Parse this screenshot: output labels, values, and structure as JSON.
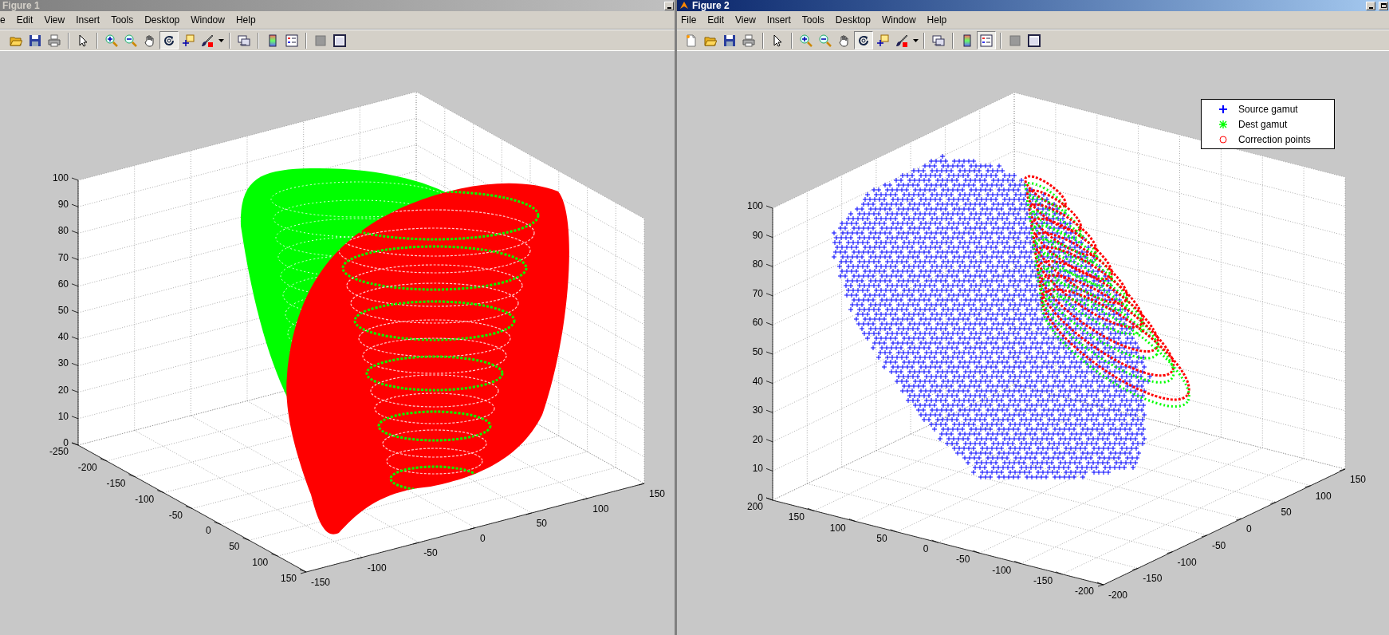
{
  "windows": [
    {
      "title": "Figure 1",
      "active": false,
      "menu": [
        "e",
        "Edit",
        "View",
        "Insert",
        "Tools",
        "Desktop",
        "Window",
        "Help"
      ],
      "toolbar": [
        [
          {
            "kind": "open",
            "pressed": false
          },
          {
            "kind": "save",
            "pressed": false
          },
          {
            "kind": "print",
            "pressed": false
          }
        ],
        [
          {
            "kind": "pointer",
            "pressed": false
          }
        ],
        [
          {
            "kind": "zoomin",
            "pressed": false
          },
          {
            "kind": "zoomout",
            "pressed": false
          },
          {
            "kind": "pan",
            "pressed": false
          },
          {
            "kind": "rotate",
            "pressed": true
          },
          {
            "kind": "datacursor",
            "pressed": false
          },
          {
            "kind": "brush",
            "pressed": false
          },
          {
            "kind": "caret",
            "pressed": false
          }
        ],
        [
          {
            "kind": "link",
            "pressed": false
          }
        ],
        [
          {
            "kind": "colorbar",
            "pressed": false
          },
          {
            "kind": "legend",
            "pressed": false
          }
        ],
        [
          {
            "kind": "hide",
            "pressed": false
          },
          {
            "kind": "dock",
            "pressed": false
          }
        ]
      ],
      "plot": {
        "kind": "surface",
        "x_ticks": [
          "-250",
          "-200",
          "-150",
          "-100",
          "-50",
          "0",
          "50",
          "100",
          "150"
        ],
        "y_ticks": [
          "-150",
          "-100",
          "-50",
          "0",
          "50",
          "100",
          "150"
        ],
        "z_ticks": [
          "100",
          "90",
          "80",
          "70",
          "60",
          "50",
          "40",
          "30",
          "20",
          "10",
          "0"
        ]
      }
    },
    {
      "title": "Figure 2",
      "active": true,
      "menu": [
        "File",
        "Edit",
        "View",
        "Insert",
        "Tools",
        "Desktop",
        "Window",
        "Help"
      ],
      "toolbar": [
        [
          {
            "kind": "new",
            "pressed": false
          },
          {
            "kind": "open",
            "pressed": false
          },
          {
            "kind": "save",
            "pressed": false
          },
          {
            "kind": "print",
            "pressed": false
          }
        ],
        [
          {
            "kind": "pointer",
            "pressed": false
          }
        ],
        [
          {
            "kind": "zoomin",
            "pressed": false
          },
          {
            "kind": "zoomout",
            "pressed": false
          },
          {
            "kind": "pan",
            "pressed": false
          },
          {
            "kind": "rotate",
            "pressed": true
          },
          {
            "kind": "datacursor",
            "pressed": false
          },
          {
            "kind": "brush",
            "pressed": false
          },
          {
            "kind": "caret",
            "pressed": false
          }
        ],
        [
          {
            "kind": "link",
            "pressed": false
          }
        ],
        [
          {
            "kind": "colorbar",
            "pressed": false
          },
          {
            "kind": "legend",
            "pressed": true
          }
        ],
        [
          {
            "kind": "hide",
            "pressed": false
          },
          {
            "kind": "dock",
            "pressed": false
          }
        ]
      ],
      "plot": {
        "kind": "scatter",
        "x_ticks": [
          "200",
          "150",
          "100",
          "50",
          "0",
          "-50",
          "-100",
          "-150",
          "-200"
        ],
        "y_ticks": [
          "-200",
          "-150",
          "-100",
          "-50",
          "0",
          "50",
          "100",
          "150"
        ],
        "z_ticks": [
          "100",
          "90",
          "80",
          "70",
          "60",
          "50",
          "40",
          "30",
          "20",
          "10",
          "0"
        ],
        "legend": [
          {
            "label": "Source gamut",
            "color": "#0000ff",
            "kind": "plus"
          },
          {
            "label": "Dest gamut",
            "color": "#00ff00",
            "kind": "star"
          },
          {
            "label": "Correction points",
            "color": "#ff0000",
            "kind": "circle"
          }
        ]
      }
    }
  ]
}
